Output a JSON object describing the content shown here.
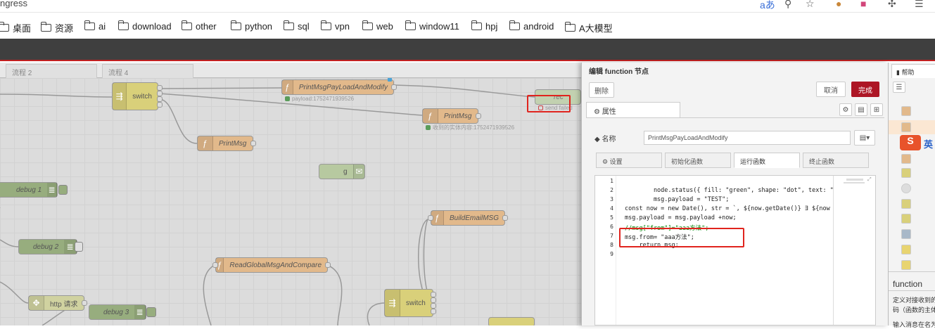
{
  "browser": {
    "url_fragment": "ngress",
    "icons": [
      "translate-icon",
      "zoom-icon",
      "star-icon",
      "cookie-icon",
      "extension-icon",
      "puzzle-icon",
      "menu-icon"
    ],
    "bookmarks": [
      "桌面",
      "资源",
      "ai",
      "download",
      "other",
      "python",
      "sql",
      "vpn",
      "web",
      "window11",
      "hpj",
      "android",
      "A大模型"
    ]
  },
  "workspace": {
    "tabs": [
      "流程 2",
      "流程 4"
    ],
    "nodes": {
      "switch1": "switch",
      "print_modify": "PrintMsgPayLoadAndModify",
      "printmsg1": "PrintMsg",
      "printmsg2": "PrintMsg",
      "g": "g",
      "debug1": "debug 1",
      "debug2": "debug 2",
      "debug3": "debug 3",
      "build_email": "BuildEmailMSG",
      "read_global": "ReadGlobalMsgAndCompare",
      "http": "http 请求",
      "switch2": "switch",
      "partial_node": "rec"
    },
    "status": {
      "payload": "payload:1752471939526",
      "received": "收到的实体内容:1752471939526",
      "send_failed": "send failed"
    }
  },
  "editor": {
    "title": "编辑 function 节点",
    "delete": "删除",
    "cancel": "取消",
    "done": "完成",
    "props_tab": "属性",
    "name_label": "名称",
    "name_value": "PrintMsgPayLoadAndModify",
    "tabs": [
      "设置",
      "初始化函数",
      "运行函数",
      "终止函数"
    ],
    "line_numbers": [
      "1",
      "2",
      "3",
      "4",
      "5",
      "6",
      "7",
      "8",
      "9"
    ],
    "code": [
      "",
      "        node.status({ fill: \"green\", shape: \"dot\", text: \"",
      "        msg.payload = \"TEST\";",
      "const now = new Date(), str = `, ${now.getDate()} ∃ ${now",
      "msg.payload = msg.payload +now;",
      "//msg[\"from\"]=\"aaa方法\";",
      "msg.from= \"aaa方法\";",
      "    return msg;",
      ""
    ]
  },
  "help": {
    "tab": "帮助",
    "node_name": "function",
    "desc1": "定义对接收到的",
    "desc2": "码（函数的主体",
    "desc3": "输入消息在名为",
    "ime": "英"
  },
  "colors": {
    "accent_red": "#ad1625",
    "annotation_red": "#e0241e",
    "function_node": "#e2b98b",
    "switch_node": "#d9d07a",
    "debug_node": "#97ad7e"
  }
}
